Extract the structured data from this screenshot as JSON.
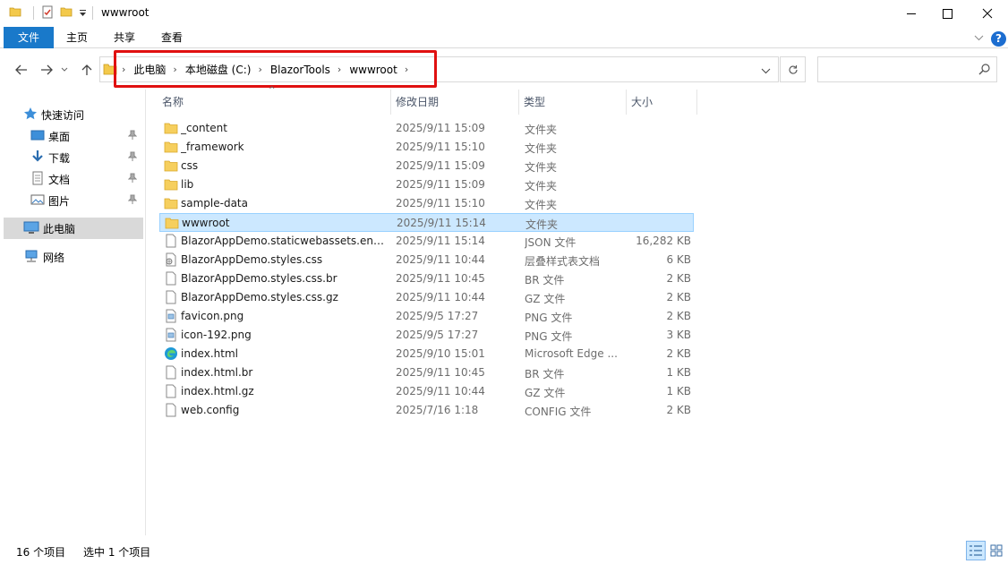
{
  "window": {
    "title": "wwwroot"
  },
  "ribbon": {
    "tabs": [
      "文件",
      "主页",
      "共享",
      "查看"
    ]
  },
  "breadcrumbs": [
    "此电脑",
    "本地磁盘 (C:)",
    "BlazorTools",
    "wwwroot"
  ],
  "sidebar": {
    "items": [
      {
        "label": "快速访问",
        "icon": "star-icon"
      },
      {
        "label": "桌面",
        "icon": "desktop-icon"
      },
      {
        "label": "下载",
        "icon": "download-icon"
      },
      {
        "label": "文档",
        "icon": "document-icon"
      },
      {
        "label": "图片",
        "icon": "pictures-icon"
      },
      {
        "label": "此电脑",
        "icon": "computer-icon"
      },
      {
        "label": "网络",
        "icon": "network-icon"
      }
    ]
  },
  "columns": [
    "名称",
    "修改日期",
    "类型",
    "大小"
  ],
  "files": [
    {
      "name": "_content",
      "date": "2025/9/11 15:09",
      "type": "文件夹",
      "size": "",
      "kind": "folder"
    },
    {
      "name": "_framework",
      "date": "2025/9/11 15:10",
      "type": "文件夹",
      "size": "",
      "kind": "folder"
    },
    {
      "name": "css",
      "date": "2025/9/11 15:09",
      "type": "文件夹",
      "size": "",
      "kind": "folder"
    },
    {
      "name": "lib",
      "date": "2025/9/11 15:09",
      "type": "文件夹",
      "size": "",
      "kind": "folder"
    },
    {
      "name": "sample-data",
      "date": "2025/9/11 15:10",
      "type": "文件夹",
      "size": "",
      "kind": "folder"
    },
    {
      "name": "wwwroot",
      "date": "2025/9/11 15:14",
      "type": "文件夹",
      "size": "",
      "kind": "folder"
    },
    {
      "name": "BlazorAppDemo.staticwebassets.end...",
      "date": "2025/9/11 15:14",
      "type": "JSON 文件",
      "size": "16,282 KB",
      "kind": "file"
    },
    {
      "name": "BlazorAppDemo.styles.css",
      "date": "2025/9/11 10:44",
      "type": "层叠样式表文档",
      "size": "6 KB",
      "kind": "css"
    },
    {
      "name": "BlazorAppDemo.styles.css.br",
      "date": "2025/9/11 10:45",
      "type": "BR 文件",
      "size": "2 KB",
      "kind": "file"
    },
    {
      "name": "BlazorAppDemo.styles.css.gz",
      "date": "2025/9/11 10:44",
      "type": "GZ 文件",
      "size": "2 KB",
      "kind": "file"
    },
    {
      "name": "favicon.png",
      "date": "2025/9/5 17:27",
      "type": "PNG 文件",
      "size": "2 KB",
      "kind": "image"
    },
    {
      "name": "icon-192.png",
      "date": "2025/9/5 17:27",
      "type": "PNG 文件",
      "size": "3 KB",
      "kind": "image"
    },
    {
      "name": "index.html",
      "date": "2025/9/10 15:01",
      "type": "Microsoft Edge ...",
      "size": "2 KB",
      "kind": "edge"
    },
    {
      "name": "index.html.br",
      "date": "2025/9/11 10:45",
      "type": "BR 文件",
      "size": "1 KB",
      "kind": "file"
    },
    {
      "name": "index.html.gz",
      "date": "2025/9/11 10:44",
      "type": "GZ 文件",
      "size": "1 KB",
      "kind": "file"
    },
    {
      "name": "web.config",
      "date": "2025/7/16 1:18",
      "type": "CONFIG 文件",
      "size": "2 KB",
      "kind": "file"
    }
  ],
  "selected_index": 5,
  "status": {
    "count": "16 个项目",
    "selection": "选中 1 个项目"
  },
  "colors": {
    "accent": "#1979ca",
    "selection": "#cce8ff",
    "highlight_border": "#e01010"
  }
}
